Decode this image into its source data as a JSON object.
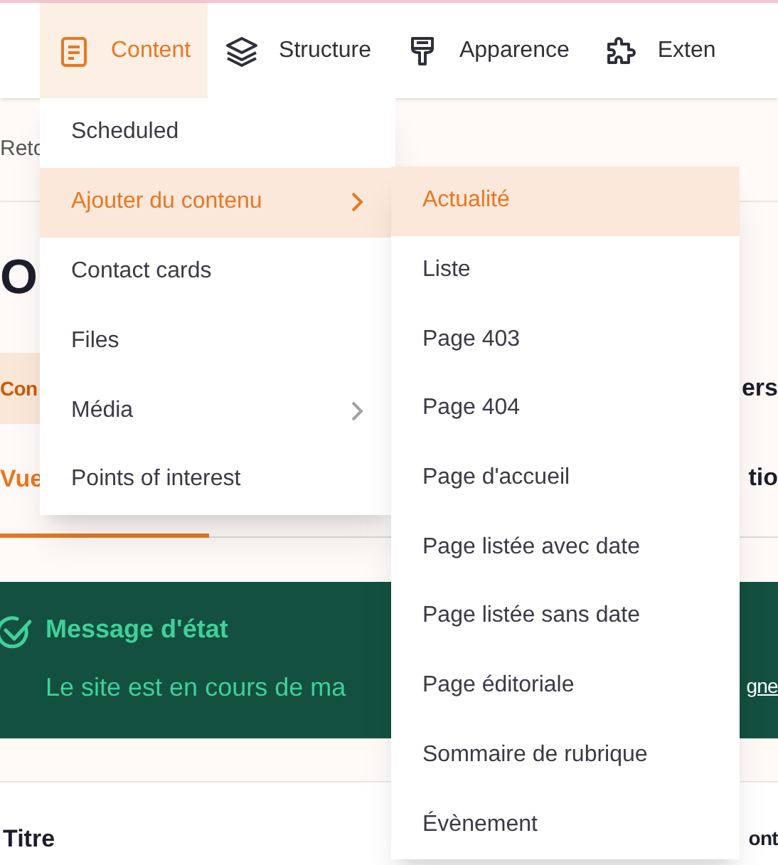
{
  "nav": [
    {
      "label": "Content",
      "selected": true
    },
    {
      "label": "Structure",
      "selected": false
    },
    {
      "label": "Apparence",
      "selected": false
    },
    {
      "label": "Exten",
      "selected": false
    }
  ],
  "breadcrumb": "Reto",
  "heading": "O",
  "tabs": [
    {
      "label": "Con",
      "selected": true
    },
    {
      "label": "ers",
      "selected": false
    }
  ],
  "subtabs": [
    {
      "label": "Vue",
      "selected": true
    },
    {
      "label": "tio",
      "selected": false
    }
  ],
  "message": {
    "title": "Message d'état",
    "text": "Le site est en cours de ma",
    "link": "gne"
  },
  "table": {
    "columns": [
      "Titre",
      "ont"
    ]
  },
  "menu": [
    {
      "label": "Scheduled",
      "selected": false,
      "submenu": false
    },
    {
      "label": "Ajouter du contenu",
      "selected": true,
      "submenu": true
    },
    {
      "label": "Contact cards",
      "selected": false,
      "submenu": false
    },
    {
      "label": "Files",
      "selected": false,
      "submenu": false
    },
    {
      "label": "Média",
      "selected": false,
      "submenu": true
    },
    {
      "label": "Points of interest",
      "selected": false,
      "submenu": false
    }
  ],
  "submenu": [
    {
      "label": "Actualité",
      "selected": true
    },
    {
      "label": "Liste",
      "selected": false
    },
    {
      "label": "Page 403",
      "selected": false
    },
    {
      "label": "Page 404",
      "selected": false
    },
    {
      "label": "Page d'accueil",
      "selected": false
    },
    {
      "label": "Page listée avec date",
      "selected": false
    },
    {
      "label": "Page listée sans date",
      "selected": false
    },
    {
      "label": "Page éditoriale",
      "selected": false
    },
    {
      "label": "Sommaire de rubrique",
      "selected": false
    },
    {
      "label": "Évènement",
      "selected": false
    }
  ]
}
